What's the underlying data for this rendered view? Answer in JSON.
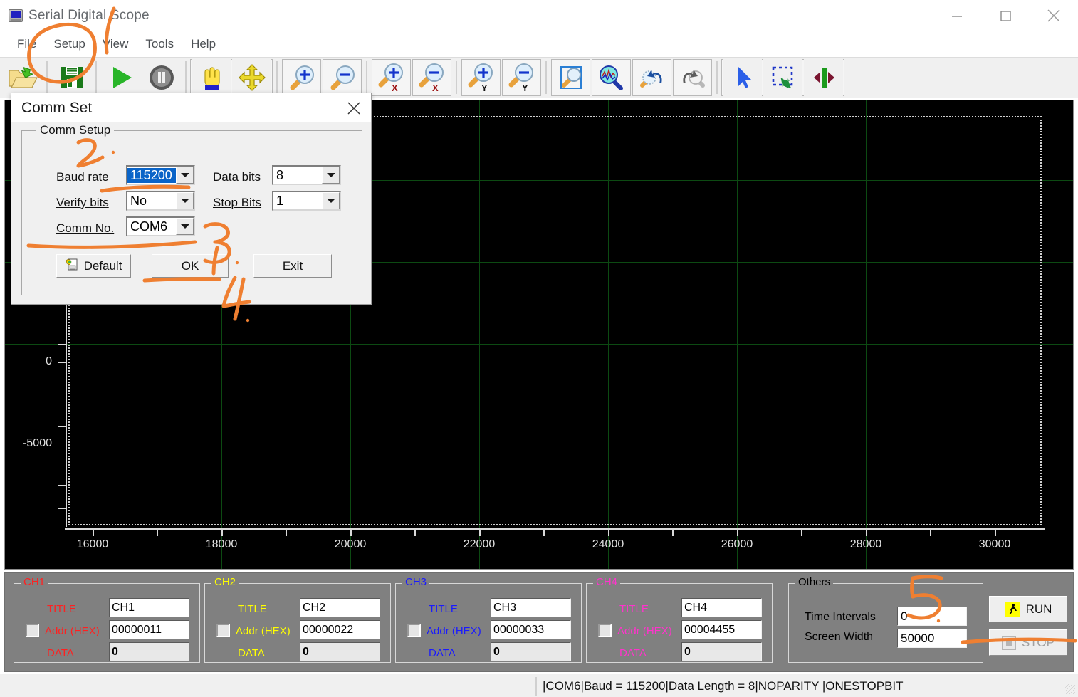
{
  "window": {
    "title": "Serial Digital Scope",
    "icon": "scope-app-icon",
    "minimize": "minimize-icon",
    "maximize": "maximize-icon",
    "close": "close-icon"
  },
  "menu": {
    "items": [
      "File",
      "Setup",
      "View",
      "Tools",
      "Help"
    ]
  },
  "toolbar": {
    "groups": [
      {
        "buttons": [
          {
            "name": "open-file-button",
            "icon": "open-folder-icon"
          },
          {
            "name": "save-file-button",
            "icon": "floppy-save-icon"
          }
        ]
      },
      {
        "buttons": [
          {
            "name": "play-button",
            "icon": "play-triangle-icon"
          },
          {
            "name": "pause-button",
            "icon": "pause-circle-icon"
          }
        ]
      },
      {
        "buttons": [
          {
            "name": "pan-hand-button",
            "icon": "hand-icon"
          },
          {
            "name": "move-button",
            "icon": "four-arrows-icon"
          }
        ]
      },
      {
        "buttons": [
          {
            "name": "zoom-in-button",
            "icon": "magnifier-plus-icon"
          },
          {
            "name": "zoom-out-button",
            "icon": "magnifier-minus-icon"
          }
        ]
      },
      {
        "buttons": [
          {
            "name": "zoom-in-x-button",
            "icon": "magnifier-plus-x-icon"
          },
          {
            "name": "zoom-out-x-button",
            "icon": "magnifier-minus-x-icon"
          }
        ]
      },
      {
        "buttons": [
          {
            "name": "zoom-in-y-button",
            "icon": "magnifier-plus-y-icon"
          },
          {
            "name": "zoom-out-y-button",
            "icon": "magnifier-minus-y-icon"
          }
        ]
      },
      {
        "buttons": [
          {
            "name": "zoom-to-window-button",
            "icon": "magnifier-rect-icon"
          },
          {
            "name": "zoom-fit-data-button",
            "icon": "magnifier-wave-icon"
          },
          {
            "name": "zoom-undo-button",
            "icon": "magnifier-undo-icon"
          },
          {
            "name": "zoom-redo-button",
            "icon": "magnifier-redo-icon"
          }
        ]
      },
      {
        "buttons": [
          {
            "name": "pointer-select-button",
            "icon": "arrow-cursor-icon"
          },
          {
            "name": "rubber-band-select-button",
            "icon": "marquee-select-icon"
          },
          {
            "name": "cursor-markers-button",
            "icon": "vertical-cursors-icon"
          }
        ]
      }
    ]
  },
  "dialog": {
    "title": "Comm Set",
    "group_legend": "Comm Setup",
    "fields": {
      "baud_rate": {
        "label": "Baud rate",
        "value": "115200"
      },
      "verify_bits": {
        "label": "Verify bits",
        "value": "No"
      },
      "comm_no": {
        "label": "Comm No.",
        "value": "COM6"
      },
      "data_bits": {
        "label": "Data bits",
        "value": "8"
      },
      "stop_bits": {
        "label": "Stop Bits",
        "value": "1"
      }
    },
    "buttons": {
      "default": "Default",
      "ok": "OK",
      "exit": "Exit"
    }
  },
  "channels": [
    {
      "name": "CH1",
      "legend": "CH1",
      "color": "#ff2020",
      "title_label": "TITLE",
      "title_value": "CH1",
      "addr_label": "Addr (HEX)",
      "addr_value": "00000011",
      "addr_checked": false,
      "data_label": "DATA",
      "data_value": "0"
    },
    {
      "name": "CH2",
      "legend": "CH2",
      "color": "#ffff00",
      "title_label": "TITLE",
      "title_value": "CH2",
      "addr_label": "Addr (HEX)",
      "addr_value": "00000022",
      "addr_checked": false,
      "data_label": "DATA",
      "data_value": "0"
    },
    {
      "name": "CH3",
      "legend": "CH3",
      "color": "#0000ff",
      "title_label": "TITLE",
      "title_value": "CH3",
      "addr_label": "Addr (HEX)",
      "addr_value": "00000033",
      "addr_checked": false,
      "data_label": "DATA",
      "data_value": "0"
    },
    {
      "name": "CH4",
      "legend": "CH4",
      "color": "#ff00ff",
      "title_label": "TITLE",
      "title_value": "CH4",
      "addr_label": "Addr (HEX)",
      "addr_value": "00004455",
      "addr_checked": false,
      "data_label": "DATA",
      "data_value": "0"
    }
  ],
  "others": {
    "legend": "Others",
    "time_intervals_label": "Time Intervals",
    "time_intervals_value": "0",
    "screen_width_label": "Screen Width",
    "screen_width_value": "50000"
  },
  "actions": {
    "run_label": "RUN",
    "run_icon": "running-man-icon",
    "stop_label": "STOP",
    "stop_icon": "stop-square-icon",
    "stop_disabled": true
  },
  "statusbar": {
    "text": "|COM6|Baud = 115200|Data Length = 8|NOPARITY  |ONESTOPBIT",
    "grip": "resize-grip-icon"
  },
  "annotations": {
    "color": "#ef7f31",
    "marks": [
      {
        "name": "circle-around-setup-menu",
        "shape": "ellipse"
      },
      {
        "name": "line-to-view-menu",
        "shape": "curve"
      },
      {
        "name": "digit-2-callout",
        "text": "2"
      },
      {
        "name": "underline-baud-rate",
        "shape": "line"
      },
      {
        "name": "digit-3-callout",
        "text": "3"
      },
      {
        "name": "underline-buttons-row",
        "shape": "line"
      },
      {
        "name": "underline-ok-button",
        "shape": "line"
      },
      {
        "name": "digit-4-callout",
        "text": "4"
      },
      {
        "name": "digit-5-callout",
        "text": "5"
      },
      {
        "name": "circle-time-intervals",
        "shape": "curve"
      },
      {
        "name": "line-to-stop-button",
        "shape": "line"
      }
    ]
  },
  "chart_data": {
    "type": "line",
    "title": "",
    "xlabel": "",
    "ylabel": "",
    "series": [],
    "x_ticks": [
      16000,
      18000,
      20000,
      22000,
      24000,
      26000,
      28000,
      30000
    ],
    "y_ticks": [
      0,
      -5000
    ],
    "y_minor_ticks": 5,
    "xlim": [
      15100,
      30900
    ],
    "ylim": [
      -8600,
      6200
    ],
    "grid": true,
    "background": "#000000",
    "grid_color": "#0c4a12",
    "legend": "none",
    "note": "Empty scope trace area; no data captured yet"
  }
}
